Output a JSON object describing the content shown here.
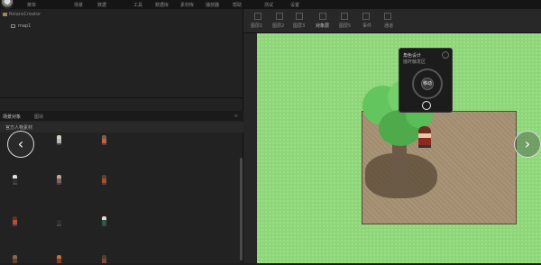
{
  "menu": {
    "items": [
      {
        "label": "菜单"
      },
      {
        "label": "场景"
      },
      {
        "label": "数据"
      },
      {
        "label": "工具"
      },
      {
        "label": "数据库"
      },
      {
        "label": "素材库"
      },
      {
        "label": "播放器"
      },
      {
        "label": "帮助"
      },
      {
        "label": "测试"
      },
      {
        "label": "设置"
      }
    ]
  },
  "project_tree": {
    "root_label": "RolansCreator",
    "maps": [
      {
        "label": "map1"
      }
    ]
  },
  "lower_panel": {
    "tabs": [
      {
        "label": "场景对象"
      },
      {
        "label": "图块"
      }
    ],
    "collapse_glyph": "≡",
    "category_label": "官方人物素材"
  },
  "toolbar": {
    "tabs": [
      {
        "label": "图层1"
      },
      {
        "label": "图层2"
      },
      {
        "label": "图层3"
      },
      {
        "label": "对象层"
      },
      {
        "label": "图层5"
      },
      {
        "label": "事件"
      },
      {
        "label": "通道"
      }
    ],
    "active_index": 3
  },
  "popup": {
    "title": "角色设计",
    "subtitle": "摇杆触发区",
    "knob_label": "移动"
  },
  "carousel": {
    "prev_glyph": "‹",
    "next_glyph": "›"
  },
  "colors": {
    "grass": "#8fd67a",
    "dirt": "#a99476",
    "panel_bg": "#222222",
    "foliage": "#5cc05a"
  }
}
